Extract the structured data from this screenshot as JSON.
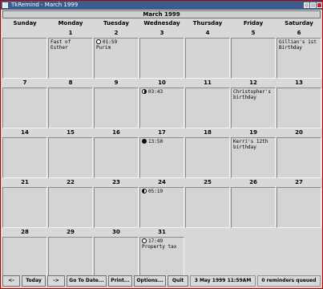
{
  "window": {
    "title": "TkRemind - March 1999"
  },
  "calendar": {
    "month_label": "March 1999",
    "day_headers": [
      "Sunday",
      "Monday",
      "Tuesday",
      "Wednesday",
      "Thursday",
      "Friday",
      "Saturday"
    ],
    "weeks": [
      [
        {
          "day": ""
        },
        {
          "day": "1"
        },
        {
          "day": "2"
        },
        {
          "day": "3"
        },
        {
          "day": "4"
        },
        {
          "day": "5"
        },
        {
          "day": "6"
        }
      ],
      [
        {
          "day": "7"
        },
        {
          "day": "8"
        },
        {
          "day": "9"
        },
        {
          "day": "10"
        },
        {
          "day": "11"
        },
        {
          "day": "12"
        },
        {
          "day": "13"
        }
      ],
      [
        {
          "day": "14"
        },
        {
          "day": "15"
        },
        {
          "day": "16"
        },
        {
          "day": "17"
        },
        {
          "day": "18"
        },
        {
          "day": "19"
        },
        {
          "day": "20"
        }
      ],
      [
        {
          "day": "21"
        },
        {
          "day": "22"
        },
        {
          "day": "23"
        },
        {
          "day": "24"
        },
        {
          "day": "25"
        },
        {
          "day": "26"
        },
        {
          "day": "27"
        }
      ],
      [
        {
          "day": "28"
        },
        {
          "day": "29"
        },
        {
          "day": "30"
        },
        {
          "day": "31"
        },
        {
          "day": ""
        },
        {
          "day": ""
        },
        {
          "day": ""
        }
      ]
    ],
    "events": {
      "1": {
        "text": "Fast of Esther"
      },
      "2": {
        "moon": "new-moon-icon",
        "time": "01:59",
        "text": "Purim"
      },
      "6": {
        "text": "Gillian's 1st Birthday"
      },
      "10": {
        "moon": "last-quarter-moon-icon",
        "time": "03:43"
      },
      "12": {
        "text": "Christopher's birthday"
      },
      "17": {
        "moon": "full-moon-icon",
        "time": "13:50"
      },
      "19": {
        "text": "Kerri's 12th birthday"
      },
      "24": {
        "moon": "first-quarter-moon-icon",
        "time": "05:19"
      },
      "31": {
        "moon": "new-moon-icon",
        "time": "17:49",
        "text": "Property tax"
      }
    }
  },
  "toolbar": {
    "prev_label": "<-",
    "today_label": "Today",
    "next_label": "->",
    "goto_label": "Go To Date...",
    "print_label": "Print...",
    "options_label": "Options...",
    "quit_label": "Quit",
    "datetime": "3 May 1999 11:59AM",
    "queue_status": "0 reminders queued"
  }
}
